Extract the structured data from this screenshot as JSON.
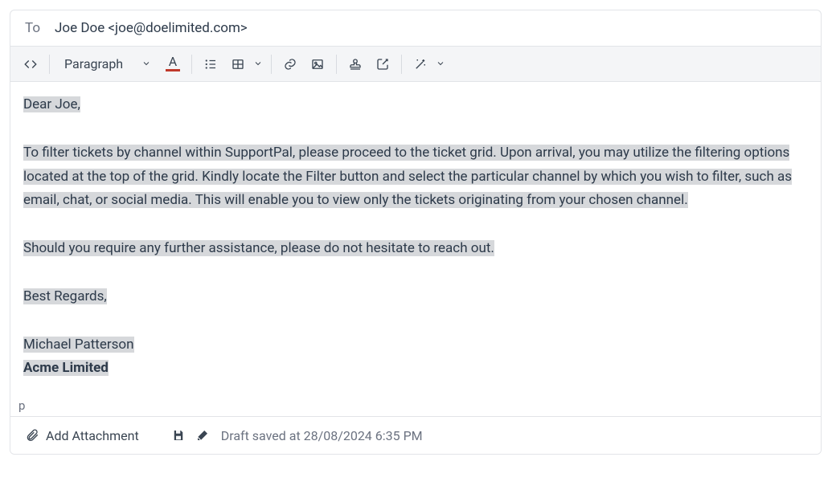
{
  "to": {
    "label": "To",
    "value": "Joe Doe <joe@doelimited.com>"
  },
  "toolbar": {
    "format_label": "Paragraph"
  },
  "body": {
    "greeting": "Dear Joe,",
    "p1": "To filter tickets by channel within SupportPal, please proceed to the ticket grid. Upon arrival, you may utilize the filtering options located at the top of the grid. Kindly locate the Filter button and select the particular channel by which you wish to filter, such as email, chat, or social media. This will enable you to view only the tickets originating from your chosen channel.",
    "p2": "Should you require any further assistance, please do not hesitate to reach out.",
    "signoff": "Best Regards,",
    "sender_name": "Michael Patterson",
    "sender_company": "Acme Limited"
  },
  "path": "p",
  "footer": {
    "attach_label": "Add Attachment",
    "draft_status": "Draft saved at 28/08/2024 6:35 PM"
  }
}
